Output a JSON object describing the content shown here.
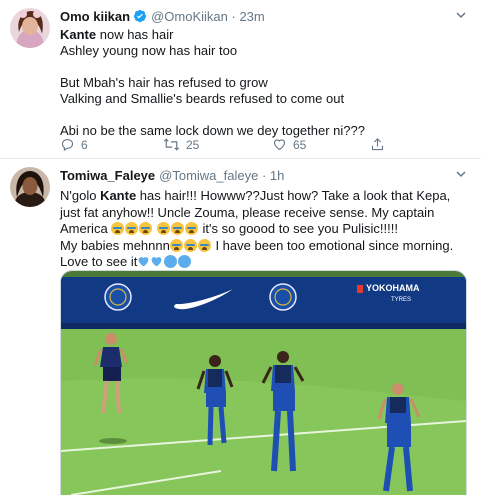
{
  "tweet1": {
    "name": "Omo kiikan",
    "handle": "@OmoKiikan",
    "dot": "·",
    "time": "23m",
    "line1_kw": "Kante",
    "line1_rest": " now has hair",
    "line2": "Ashley young now has hair too",
    "line3": "But Mbah's hair has refused to grow",
    "line4": "Valking and Smallie's  beards refused to come out",
    "line5": "Abi no be the same lock down we dey together ni???",
    "replies": "6",
    "retweets": "25",
    "likes": "65"
  },
  "tweet2": {
    "name": "Tomiwa_Faleye",
    "handle": "@Tomiwa_faleye",
    "dot": "·",
    "time": "1h",
    "p1_a": "N'golo ",
    "p1_kw": "Kante",
    "p1_b": " has hair!!! Howww??Just how? Take a look that Kepa, just fat anyhow!! Uncle Zouma, please receive sense. My captain America ",
    "p1_c": " it's so goood to see you Pulisic!!!!!",
    "p2_a": "My babies mehnnn",
    "p2_b": " I have been too emotional since morning. Love to see it"
  },
  "media": {
    "board_text": "YOKOHAMA",
    "board_sub": "TYRES"
  },
  "colors": {
    "verified_blue": "#1da1f2",
    "secondary_text": "#657786",
    "board_blue": "#123a84",
    "pitch_green": "#86c65a"
  },
  "icons": [
    "verified-icon",
    "caret-down-icon",
    "reply-icon",
    "retweet-icon",
    "like-icon",
    "crying-emoji-icon",
    "blue-heart-icon",
    "blue-circle-icon",
    "nike-swoosh-icon",
    "chelsea-crest-icon"
  ]
}
